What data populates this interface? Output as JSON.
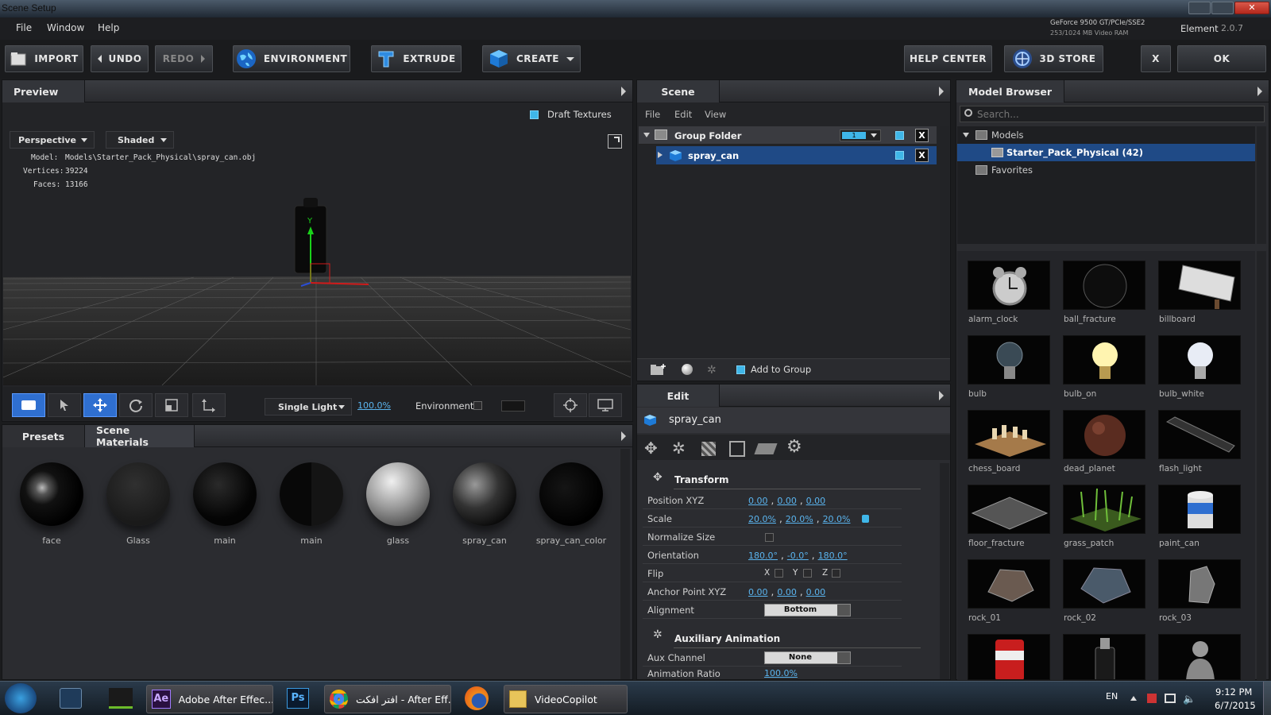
{
  "window": {
    "title": "Scene Setup",
    "gpu_name": "GeForce 9500 GT/PCIe/SSE2",
    "gpu_ram": "253/1024 MB Video RAM",
    "product": "Element",
    "version": "2.0.7"
  },
  "menu": {
    "file": "File",
    "window": "Window",
    "help": "Help"
  },
  "toolbar": {
    "import": "IMPORT",
    "undo": "UNDO",
    "redo": "REDO",
    "environment": "ENVIRONMENT",
    "extrude": "EXTRUDE",
    "create": "CREATE",
    "help_center": "HELP CENTER",
    "store": "3D STORE",
    "x": "X",
    "ok": "OK"
  },
  "preview": {
    "tab": "Preview",
    "draft_textures": "Draft Textures",
    "camera": "Perspective",
    "shading": "Shaded",
    "model_label": "Model:",
    "model_value": "Models\\Starter_Pack_Physical\\spray_can.obj",
    "vertices_label": "Vertices:",
    "vertices_value": "39224",
    "faces_label": "Faces:",
    "faces_value": "13166",
    "light": "Single Light",
    "light_pct": "100.0%",
    "environment": "Environment"
  },
  "materials": {
    "tab_presets": "Presets",
    "tab_scene": "Scene Materials",
    "items": [
      "face",
      "Glass",
      "main",
      "main",
      "glass",
      "spray_can",
      "spray_can_color"
    ]
  },
  "scene": {
    "tab": "Scene",
    "menu": [
      "File",
      "Edit",
      "View"
    ],
    "group": "Group Folder",
    "group_count": "1",
    "item": "spray_can",
    "add_to_group": "Add to Group"
  },
  "edit": {
    "tab": "Edit",
    "object": "spray_can",
    "transform": "Transform",
    "position_label": "Position XYZ",
    "position": [
      "0.00",
      "0.00",
      "0.00"
    ],
    "scale_label": "Scale",
    "scale": [
      "20.0%",
      "20.0%",
      "20.0%"
    ],
    "normalize_label": "Normalize Size",
    "orientation_label": "Orientation",
    "orientation": [
      "180.0°",
      "-0.0°",
      "180.0°"
    ],
    "flip_label": "Flip",
    "flip": [
      "X",
      "Y",
      "Z"
    ],
    "anchor_label": "Anchor Point XYZ",
    "anchor": [
      "0.00",
      "0.00",
      "0.00"
    ],
    "alignment_label": "Alignment",
    "alignment": "Bottom",
    "aux": "Auxiliary Animation",
    "aux_channel_label": "Aux Channel",
    "aux_channel": "None",
    "anim_ratio_label": "Animation Ratio",
    "anim_ratio": "100.0%"
  },
  "browser": {
    "tab": "Model Browser",
    "search_placeholder": "Search...",
    "models": "Models",
    "pack": "Starter_Pack_Physical (42)",
    "favorites": "Favorites",
    "items": [
      "alarm_clock",
      "ball_fracture",
      "billboard",
      "bulb",
      "bulb_on",
      "bulb_white",
      "chess_board",
      "dead_planet",
      "flash_light",
      "floor_fracture",
      "grass_patch",
      "paint_can",
      "rock_01",
      "rock_02",
      "rock_03",
      "",
      "",
      ""
    ]
  },
  "taskbar": {
    "ae": "Adobe After Effec...",
    "chrome": "افتر افكت - After Eff...",
    "folder": "VideoCopilot",
    "lang": "EN",
    "time": "9:12 PM",
    "date": "6/7/2015"
  },
  "colors": {
    "accent": "#3fb6e8",
    "selection": "#1f4a86"
  }
}
